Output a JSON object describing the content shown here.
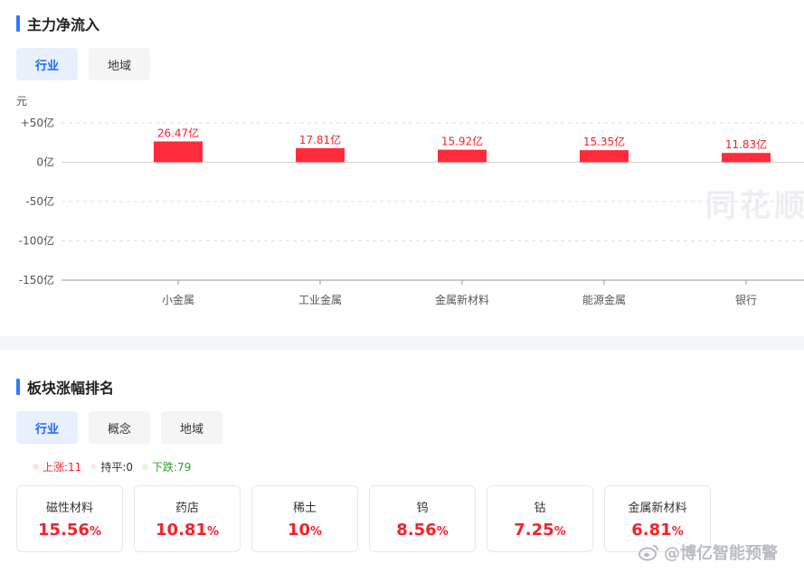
{
  "section1": {
    "title": "主力净流入",
    "tabs": [
      {
        "label": "行业",
        "active": true
      },
      {
        "label": "地域",
        "active": false
      }
    ]
  },
  "chart_data": {
    "type": "bar",
    "unit_label": "元",
    "categories": [
      "小金属",
      "工业金属",
      "金属新材料",
      "能源金属",
      "银行"
    ],
    "values": [
      26.47,
      17.81,
      15.92,
      15.35,
      11.83
    ],
    "data_labels": [
      "26.47亿",
      "17.81亿",
      "15.92亿",
      "15.35亿",
      "11.83亿"
    ],
    "y_ticks": [
      {
        "value": 50,
        "label": "+50亿"
      },
      {
        "value": 0,
        "label": "0亿"
      },
      {
        "value": -50,
        "label": "-50亿"
      },
      {
        "value": -100,
        "label": "-100亿"
      },
      {
        "value": -150,
        "label": "-150亿"
      }
    ],
    "ylim": [
      -150,
      50
    ],
    "grid": true,
    "bar_color": "#ff2b3a",
    "watermark": "同花顺"
  },
  "section2": {
    "title": "板块涨幅排名",
    "tabs": [
      {
        "label": "行业",
        "active": true
      },
      {
        "label": "概念",
        "active": false
      },
      {
        "label": "地域",
        "active": false
      }
    ],
    "legend": [
      {
        "label": "上涨:11",
        "color": "#f5222d",
        "dot": "#fde2e2"
      },
      {
        "label": "持平:0",
        "color": "#333333",
        "dot": "#eeeeee"
      },
      {
        "label": "下跌:79",
        "color": "#2ca02c",
        "dot": "#e2f5e2"
      }
    ],
    "cards": [
      {
        "name": "磁性材料",
        "value": "15.56",
        "unit": "%"
      },
      {
        "name": "药店",
        "value": "10.81",
        "unit": "%"
      },
      {
        "name": "稀土",
        "value": "10",
        "unit": "%"
      },
      {
        "name": "钨",
        "value": "8.56",
        "unit": "%"
      },
      {
        "name": "钴",
        "value": "7.25",
        "unit": "%"
      },
      {
        "name": "金属新材料",
        "value": "6.81",
        "unit": "%"
      }
    ]
  },
  "weibo": {
    "text": "@博亿智能预警",
    "icon": "weibo-icon"
  },
  "colors": {
    "accent": "#3377ff",
    "up": "#f5222d",
    "down": "#2ca02c",
    "active_tab": "#1a66ff"
  }
}
